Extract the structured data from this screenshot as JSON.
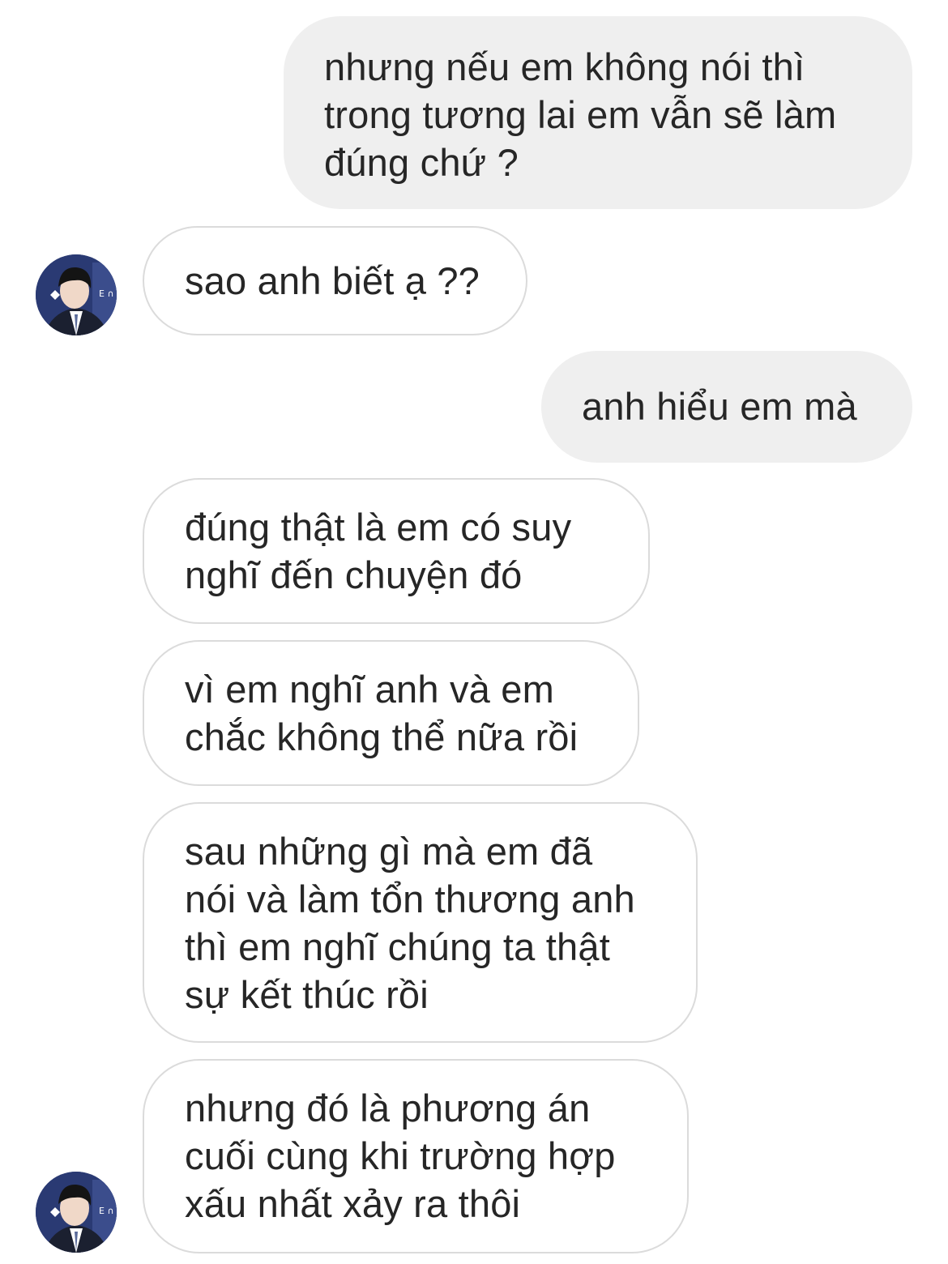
{
  "conversation": {
    "messages": [
      {
        "side": "sent",
        "text": "nhưng nếu em không nói thì\ntrong tương lai em vẫn sẽ làm\nđúng chứ ?"
      },
      {
        "side": "received",
        "text": "sao anh biết ạ ??"
      },
      {
        "side": "sent",
        "text": "anh hiểu em mà"
      },
      {
        "side": "received",
        "text": "đúng thật là em có suy\nnghĩ đến chuyện đó"
      },
      {
        "side": "received",
        "text": "vì em nghĩ anh và em\nchắc không thể nữa rồi"
      },
      {
        "side": "received",
        "text": "sau những gì mà em đã\nnói và làm tổn thương anh\nthì em nghĩ chúng ta thật\nsự kết thúc rồi"
      },
      {
        "side": "received",
        "text": "nhưng đó là phương án\ncuối cùng khi trường hợp\nxấu nhất xảy ra thôi"
      }
    ],
    "avatar": {
      "icon": "profile-photo-avatar",
      "badge_text": "E ∩"
    }
  },
  "colors": {
    "sent_bubble": "#efefef",
    "received_border": "#dbdbdb",
    "text": "#262626",
    "avatar_bg": "#2a3a73"
  }
}
